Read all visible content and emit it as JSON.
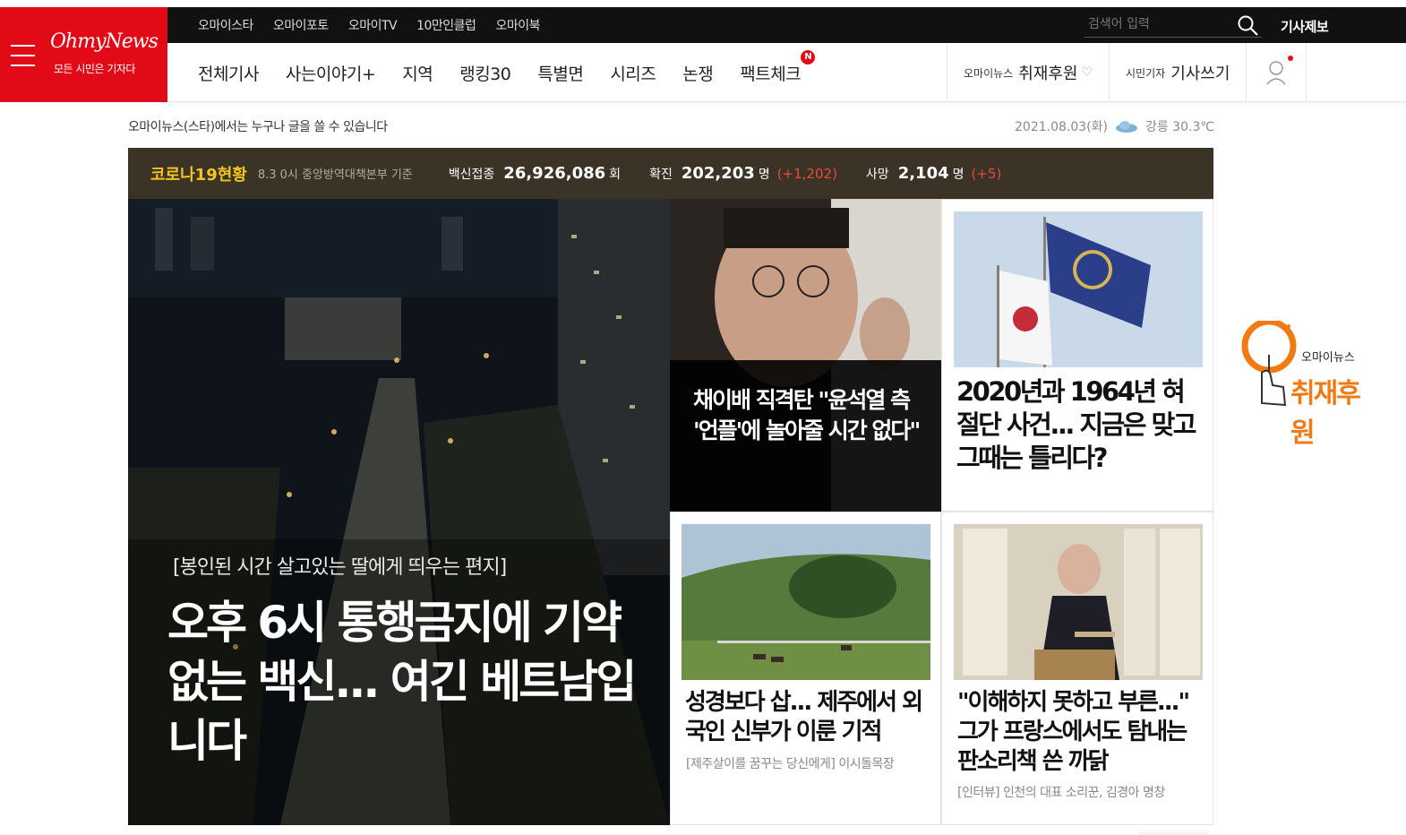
{
  "logo": {
    "brand": "OhmyNews",
    "slogan": "모든 시민은 기자다"
  },
  "topbar": {
    "sites": [
      "오마이스타",
      "오마이포토",
      "오마이TV",
      "10만인클럽",
      "오마이북"
    ],
    "search_placeholder": "검색어 입력",
    "report": "기사제보"
  },
  "nav": {
    "menu": [
      "전체기사",
      "사는이야기+",
      "지역",
      "랭킹30",
      "특별면",
      "시리즈",
      "논쟁",
      "팩트체크"
    ],
    "new_badge": "N",
    "support_pre": "오마이뉴스",
    "support_label": "취재후원",
    "write_pre": "시민기자",
    "write_label": "기사쓰기"
  },
  "tagline": "오마이뉴스(스타)에서는 누구나 글을 쓸 수 있습니다",
  "date": "2021.08.03(화)",
  "weather": "강릉 30.3℃",
  "covid": {
    "title": "코로나19현황",
    "basis": "8.3 0시 중앙방역대책본부 기준",
    "vaccine_label": "백신접종",
    "vaccine_value": "26,926,086",
    "vaccine_unit": "회",
    "confirmed_label": "확진",
    "confirmed_value": "202,203",
    "confirmed_unit": "명",
    "confirmed_delta": "(+1,202)",
    "death_label": "사망",
    "death_value": "2,104",
    "death_unit": "명",
    "death_delta": "(+5)"
  },
  "main_feature": {
    "kicker": "[봉인된 시간 살고있는 딸에게 띄우는 편지]",
    "title": "오후 6시 통행금지에 기약없는 백신... 여긴 베트남입니다"
  },
  "cards": [
    {
      "title": "채이배 직격탄 \"윤석열 측 '언플'에 놀아줄 시간 없다\""
    },
    {
      "title": "2020년과 1964년 혀 절단 사건... 지금은 맞고 그때는 틀리다?"
    },
    {
      "title": "성경보다 삽... 제주에서 외국인 신부가 이룬 기적",
      "sub": "[제주살이를 꿈꾸는 당신에게] 이시돌목장"
    },
    {
      "title": "\"이해하지 못하고 부른...\" 그가 프랑스에서도 탐내는 판소리책 쓴 까닭",
      "sub": "[인터뷰] 인천의 대표 소리꾼, 김경아 명창"
    }
  ],
  "float_support": {
    "small": "오마이뉴스",
    "big": "취재후원"
  },
  "colors": {
    "brand_red": "#e20a16",
    "covid_bg": "#3a3326",
    "covid_title": "#f4c51e",
    "delta_red": "#e84a3a",
    "support_orange": "#f07a14"
  }
}
